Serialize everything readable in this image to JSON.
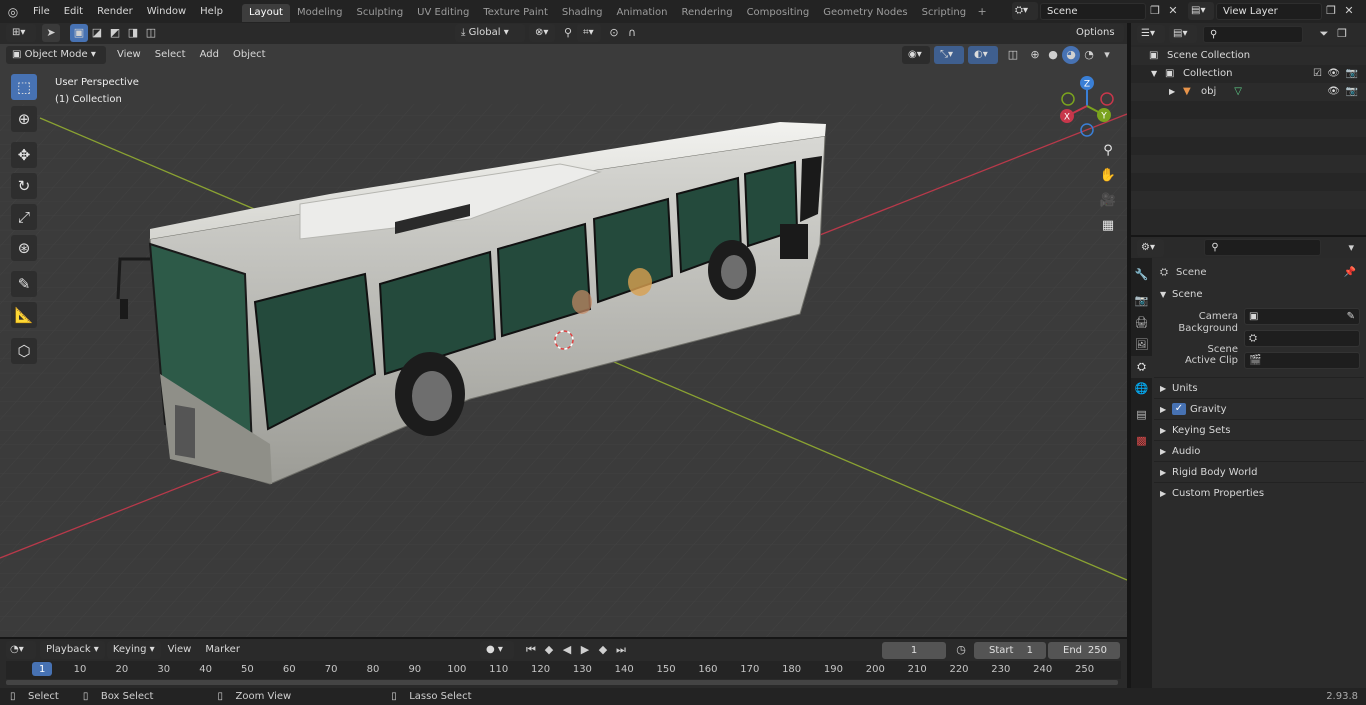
{
  "topbar": {
    "menus": [
      "File",
      "Edit",
      "Render",
      "Window",
      "Help"
    ],
    "workspaces": [
      "Layout",
      "Modeling",
      "Sculpting",
      "UV Editing",
      "Texture Paint",
      "Shading",
      "Animation",
      "Rendering",
      "Compositing",
      "Geometry Nodes",
      "Scripting"
    ],
    "active_workspace": "Layout",
    "add_tab": "+",
    "scene": "Scene",
    "view_layer": "View Layer"
  },
  "viewport_header": {
    "mode": "Object Mode",
    "menus": [
      "View",
      "Select",
      "Add",
      "Object"
    ],
    "transform_orientation": "Global",
    "options": "Options"
  },
  "viewport": {
    "perspective": "User Perspective",
    "collection": "(1) Collection",
    "gizmo_axes": [
      "Z",
      "X",
      "Y"
    ]
  },
  "outliner": {
    "rows": [
      {
        "label": "Scene Collection"
      },
      {
        "label": "Collection"
      },
      {
        "label": "obj"
      }
    ]
  },
  "properties": {
    "context": "Scene",
    "panel_title": "Scene",
    "fields": [
      {
        "label": "Camera"
      },
      {
        "label": "Background Scene"
      },
      {
        "label": "Active Clip"
      }
    ],
    "sections": [
      "Units",
      "Gravity",
      "Keying Sets",
      "Audio",
      "Rigid Body World",
      "Custom Properties"
    ]
  },
  "timeline": {
    "menus": [
      "Playback",
      "Keying",
      "View",
      "Marker"
    ],
    "current_frame": "1",
    "start_label": "Start",
    "start_value": "1",
    "end_label": "End",
    "end_value": "250",
    "ticks": [
      "1",
      "10",
      "20",
      "30",
      "40",
      "50",
      "60",
      "70",
      "80",
      "90",
      "100",
      "110",
      "120",
      "130",
      "140",
      "150",
      "160",
      "170",
      "180",
      "190",
      "200",
      "210",
      "220",
      "230",
      "240",
      "250"
    ]
  },
  "statusbar": {
    "hints": [
      "Select",
      "Box Select",
      "Zoom View",
      "Lasso Select"
    ],
    "version": "2.93.8"
  },
  "colors": {
    "accent": "#4772b3",
    "x_axis": "#c8374b",
    "y_axis": "#7aa31e",
    "z_axis": "#3a7fd6"
  }
}
